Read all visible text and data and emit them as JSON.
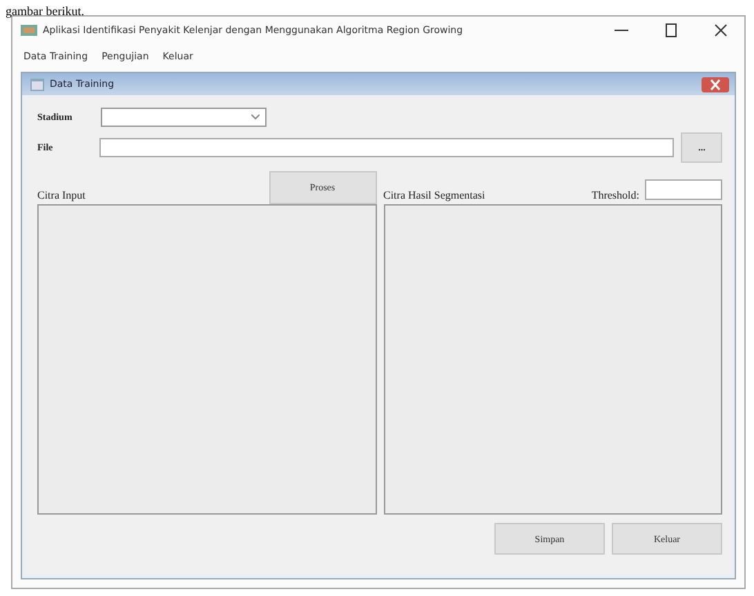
{
  "document_caption": "gambar berikut.",
  "window": {
    "title": "Aplikasi Identifikasi Penyakit Kelenjar dengan Menggunakan Algoritma Region Growing"
  },
  "menu": [
    "Data Training",
    "Pengujian",
    "Keluar"
  ],
  "child_window": {
    "title": "Data Training"
  },
  "form": {
    "stadium_label": "Stadium",
    "file_label": "File",
    "browse_button": "...",
    "process_button": "Proses",
    "input_label": "Citra Input",
    "output_label": "Citra Hasil Segmentasi",
    "threshold_label": "Threshold:"
  },
  "buttons": [
    "Simpan",
    "Keluar"
  ]
}
